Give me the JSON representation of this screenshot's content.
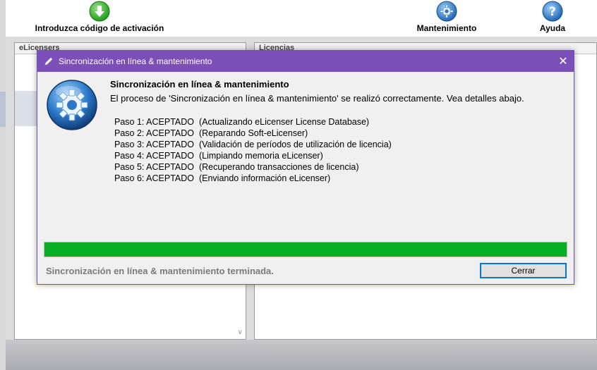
{
  "toolbar": {
    "activation": {
      "label": "Introduzca código de activación",
      "icon": "green-down-arrow-icon"
    },
    "maintenance": {
      "label": "Mantenimiento",
      "icon": "gear-icon"
    },
    "help": {
      "label": "Ayuda",
      "icon": "help-icon"
    }
  },
  "panels": {
    "left_header": "eLicensers",
    "right_header": "Licencias"
  },
  "dialog": {
    "title": "Sincronización en línea & mantenimiento",
    "close_symbol": "✕",
    "heading": "Sincronización en línea & mantenimiento",
    "message": "El proceso de 'Sincronización en línea & mantenimiento' se realizó correctamente. Vea detalles abajo.",
    "steps": [
      {
        "step": "Paso 1: ACEPTADO",
        "detail": "(Actualizando eLicenser License Database)"
      },
      {
        "step": "Paso 2: ACEPTADO",
        "detail": "(Reparando Soft-eLicenser)"
      },
      {
        "step": "Paso 3: ACEPTADO",
        "detail": "(Validación de períodos de utilización de licencia)"
      },
      {
        "step": "Paso 4: ACEPTADO",
        "detail": "(Limpiando memoria eLicenser)"
      },
      {
        "step": "Paso 5: ACEPTADO",
        "detail": "(Recuperando transacciones de licencia)"
      },
      {
        "step": "Paso 6: ACEPTADO",
        "detail": "(Enviando información eLicenser)"
      }
    ],
    "progress_percent": 100,
    "status": "Sincronización en línea & mantenimiento terminada.",
    "close_button": "Cerrar"
  },
  "colors": {
    "titlebar": "#7c4fb8",
    "progress": "#06b025",
    "button_border": "#0078d7"
  }
}
